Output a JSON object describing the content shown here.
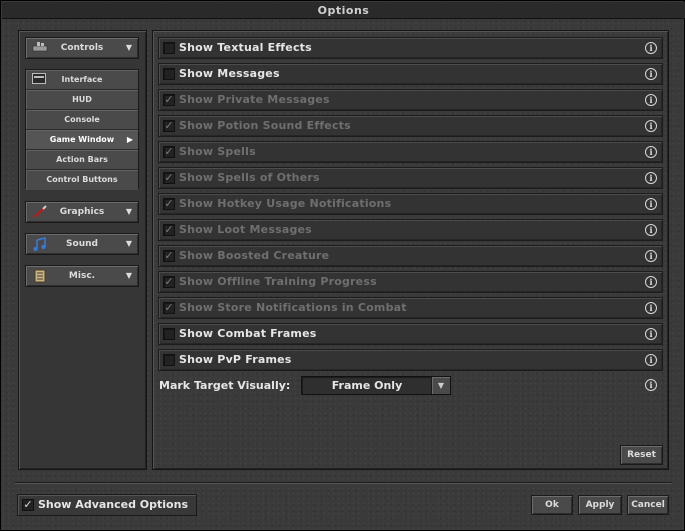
{
  "window": {
    "title": "Options"
  },
  "sidebar": {
    "categories": [
      {
        "label": "Controls",
        "icon": "controls-icon"
      },
      {
        "label": "Graphics",
        "icon": "brush-icon"
      },
      {
        "label": "Sound",
        "icon": "music-note-icon"
      },
      {
        "label": "Misc.",
        "icon": "scroll-icon"
      }
    ],
    "interface": {
      "label": "Interface",
      "icon": "interface-icon",
      "items": [
        "HUD",
        "Console",
        "Game Window",
        "Action Bars",
        "Control Buttons"
      ],
      "active": "Game Window"
    }
  },
  "options": [
    {
      "label": "Show Textual Effects",
      "checked": false,
      "enabled": true
    },
    {
      "label": "Show Messages",
      "checked": false,
      "enabled": true
    },
    {
      "label": "Show Private Messages",
      "checked": true,
      "enabled": false
    },
    {
      "label": "Show Potion Sound Effects",
      "checked": true,
      "enabled": false
    },
    {
      "label": "Show Spells",
      "checked": true,
      "enabled": false
    },
    {
      "label": "Show Spells of Others",
      "checked": true,
      "enabled": false
    },
    {
      "label": "Show Hotkey Usage Notifications",
      "checked": true,
      "enabled": false
    },
    {
      "label": "Show Loot Messages",
      "checked": true,
      "enabled": false
    },
    {
      "label": "Show Boosted Creature",
      "checked": true,
      "enabled": false
    },
    {
      "label": "Show Offline Training Progress",
      "checked": true,
      "enabled": false
    },
    {
      "label": "Show Store Notifications in Combat",
      "checked": true,
      "enabled": false
    },
    {
      "label": "Show Combat Frames",
      "checked": false,
      "enabled": true
    },
    {
      "label": "Show PvP Frames",
      "checked": false,
      "enabled": true
    }
  ],
  "mark_target": {
    "label": "Mark Target Visually:",
    "value": "Frame Only"
  },
  "buttons": {
    "reset": "Reset",
    "ok": "Ok",
    "apply": "Apply",
    "cancel": "Cancel"
  },
  "advanced": {
    "label": "Show Advanced Options",
    "checked": true
  },
  "icons": {
    "info": "info-icon",
    "checkmark": "checkmark-icon",
    "dropdown": "chevron-down-icon"
  }
}
